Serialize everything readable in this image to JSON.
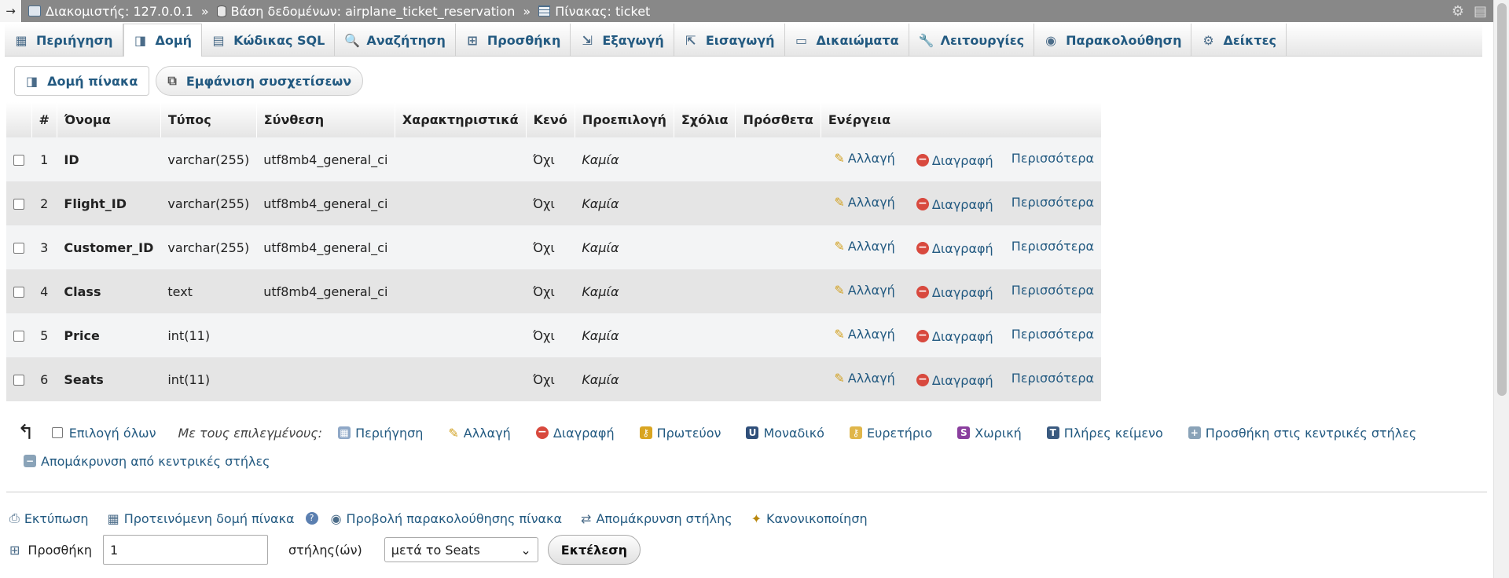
{
  "breadcrumb": {
    "arrow": "→",
    "server": "Διακομιστής: 127.0.0.1",
    "database": "Βάση δεδομένων: airplane_ticket_reservation",
    "table": "Πίνακας: ticket",
    "separator": "»"
  },
  "tabs": [
    {
      "label": "Περιήγηση",
      "icon": "▦"
    },
    {
      "label": "Δομή",
      "icon": "◨"
    },
    {
      "label": "Κώδικας SQL",
      "icon": "▤"
    },
    {
      "label": "Αναζήτηση",
      "icon": "🔍"
    },
    {
      "label": "Προσθήκη",
      "icon": "⊞"
    },
    {
      "label": "Εξαγωγή",
      "icon": "⇲"
    },
    {
      "label": "Εισαγωγή",
      "icon": "⇱"
    },
    {
      "label": "Δικαιώματα",
      "icon": "▭"
    },
    {
      "label": "Λειτουργίες",
      "icon": "🔧"
    },
    {
      "label": "Παρακολούθηση",
      "icon": "◉"
    },
    {
      "label": "Δείκτες",
      "icon": "⚙"
    }
  ],
  "subtabs": {
    "structure": "Δομή πίνακα",
    "relations": "Εμφάνιση συσχετίσεων"
  },
  "table": {
    "headers": [
      "#",
      "Όνομα",
      "Τύπος",
      "Σύνθεση",
      "Χαρακτηριστικά",
      "Κενό",
      "Προεπιλογή",
      "Σχόλια",
      "Πρόσθετα",
      "Ενέργεια"
    ],
    "rows": [
      {
        "num": "1",
        "name": "ID",
        "type": "varchar(255)",
        "collation": "utf8mb4_general_ci",
        "attributes": "",
        "null": "Όχι",
        "default": "Καμία",
        "comments": "",
        "extra": ""
      },
      {
        "num": "2",
        "name": "Flight_ID",
        "type": "varchar(255)",
        "collation": "utf8mb4_general_ci",
        "attributes": "",
        "null": "Όχι",
        "default": "Καμία",
        "comments": "",
        "extra": ""
      },
      {
        "num": "3",
        "name": "Customer_ID",
        "type": "varchar(255)",
        "collation": "utf8mb4_general_ci",
        "attributes": "",
        "null": "Όχι",
        "default": "Καμία",
        "comments": "",
        "extra": ""
      },
      {
        "num": "4",
        "name": "Class",
        "type": "text",
        "collation": "utf8mb4_general_ci",
        "attributes": "",
        "null": "Όχι",
        "default": "Καμία",
        "comments": "",
        "extra": ""
      },
      {
        "num": "5",
        "name": "Price",
        "type": "int(11)",
        "collation": "",
        "attributes": "",
        "null": "Όχι",
        "default": "Καμία",
        "comments": "",
        "extra": ""
      },
      {
        "num": "6",
        "name": "Seats",
        "type": "int(11)",
        "collation": "",
        "attributes": "",
        "null": "Όχι",
        "default": "Καμία",
        "comments": "",
        "extra": ""
      }
    ],
    "actions": {
      "change": "Αλλαγή",
      "drop": "Διαγραφή",
      "more": "Περισσότερα"
    }
  },
  "bulk": {
    "check_all": "Επιλογή όλων",
    "with_selected": "Με τους επιλεγμένους:",
    "browse": "Περιήγηση",
    "change": "Αλλαγή",
    "drop": "Διαγραφή",
    "primary": "Πρωτεύον",
    "unique": "Μοναδικό",
    "index": "Ευρετήριο",
    "spatial": "Χωρική",
    "fulltext": "Πλήρες κείμενο",
    "add_central": "Προσθήκη στις κεντρικές στήλες",
    "remove_central": "Απομάκρυνση από κεντρικές στήλες"
  },
  "bottom_links": {
    "print": "Εκτύπωση",
    "propose": "Προτεινόμενη δομή πίνακα",
    "tracking": "Προβολή παρακολούθησης πίνακα",
    "move_columns": "Απομάκρυνση στήλης",
    "normalize": "Κανονικοποίηση"
  },
  "add_columns": {
    "label": "Προσθήκη",
    "count": "1",
    "unit": "στήλης(ών)",
    "position": "μετά το Seats",
    "go": "Εκτέλεση"
  },
  "colors": {
    "link": "#235a81",
    "breadcrumb_bg": "#888888",
    "row_odd": "#f3f4f5",
    "row_even": "#e5e5e5"
  }
}
